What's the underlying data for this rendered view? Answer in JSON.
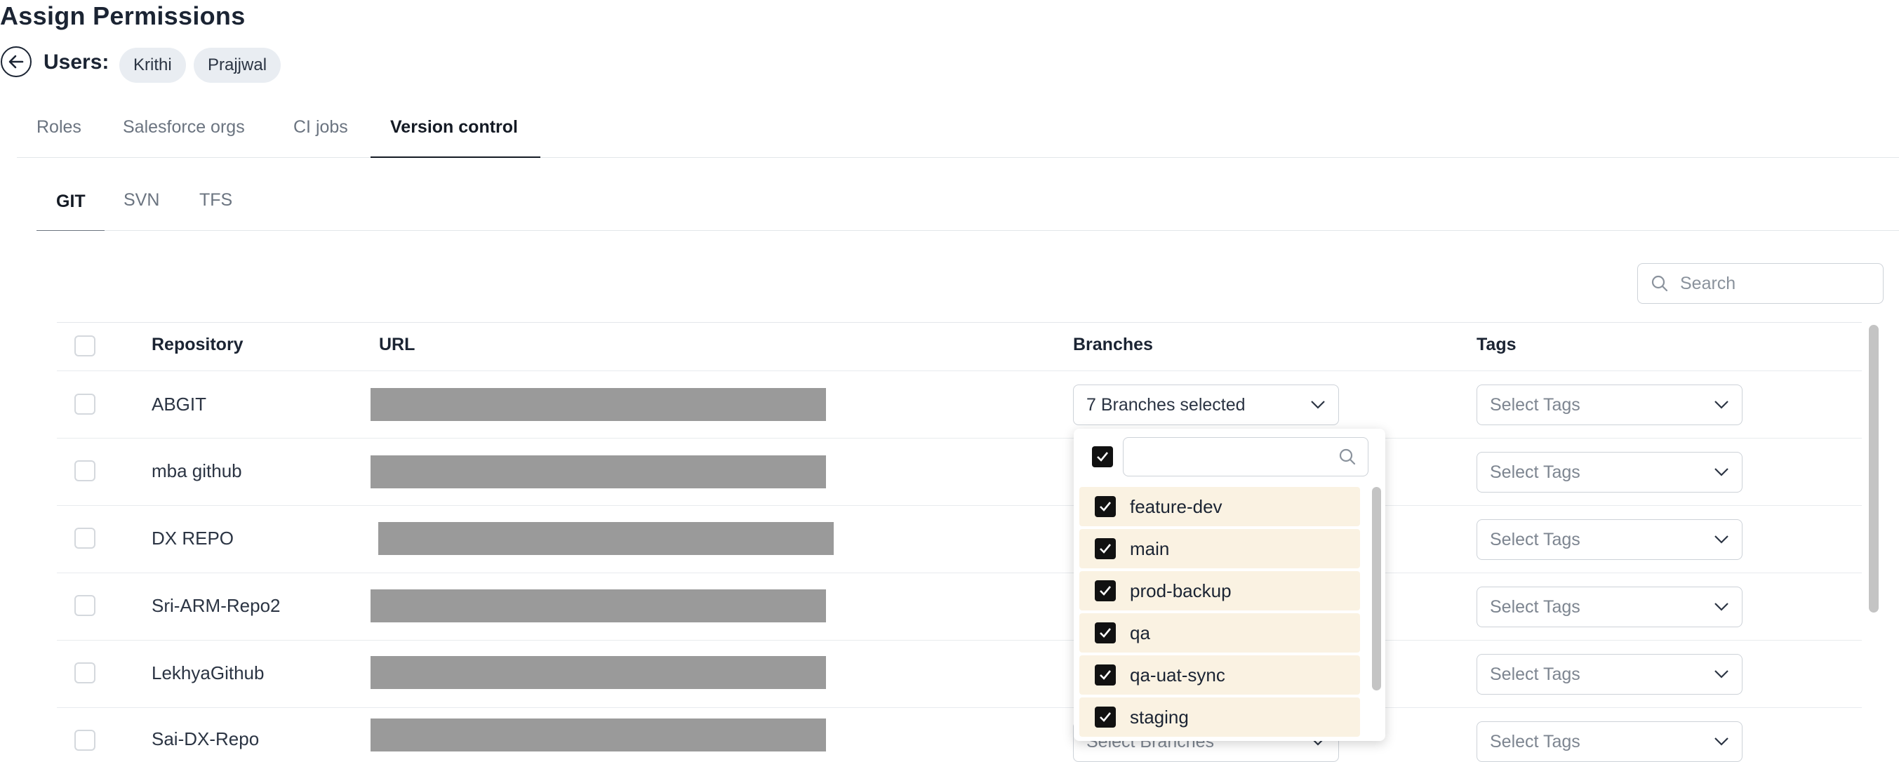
{
  "page": {
    "title": "Assign Permissions"
  },
  "users": {
    "label": "Users:",
    "chips": [
      "Krithi",
      "Prajjwal"
    ]
  },
  "main_tabs": [
    "Roles",
    "Salesforce orgs",
    "CI jobs",
    "Version control"
  ],
  "main_tabs_active": "Version control",
  "vcs_tabs": [
    "GIT",
    "SVN",
    "TFS"
  ],
  "vcs_tabs_active": "GIT",
  "search": {
    "placeholder": "Search"
  },
  "table": {
    "headers": {
      "repository": "Repository",
      "url": "URL",
      "branches": "Branches",
      "tags": "Tags"
    },
    "rows": [
      {
        "repository": "ABGIT",
        "branches": "7 Branches selected",
        "tags": "Select Tags"
      },
      {
        "repository": "mba github",
        "branches": "",
        "tags": "Select Tags"
      },
      {
        "repository": "DX REPO",
        "branches": "",
        "tags": "Select Tags"
      },
      {
        "repository": "Sri-ARM-Repo2",
        "branches": "",
        "tags": "Select Tags"
      },
      {
        "repository": "LekhyaGithub",
        "branches": "",
        "tags": "Select Tags"
      },
      {
        "repository": "Sai-DX-Repo",
        "branches": "Select Branches",
        "tags": "Select Tags"
      }
    ]
  },
  "branch_dropdown": {
    "select_all_checked": true,
    "items": [
      {
        "label": "feature-dev",
        "checked": true
      },
      {
        "label": "main",
        "checked": true
      },
      {
        "label": "prod-backup",
        "checked": true
      },
      {
        "label": "qa",
        "checked": true
      },
      {
        "label": "qa-uat-sync",
        "checked": true
      },
      {
        "label": "staging",
        "checked": true
      }
    ]
  },
  "colors": {
    "accent_dark": "#141a24",
    "selected_item_bg": "#faf2e2",
    "redaction": "#9a9a9a"
  }
}
